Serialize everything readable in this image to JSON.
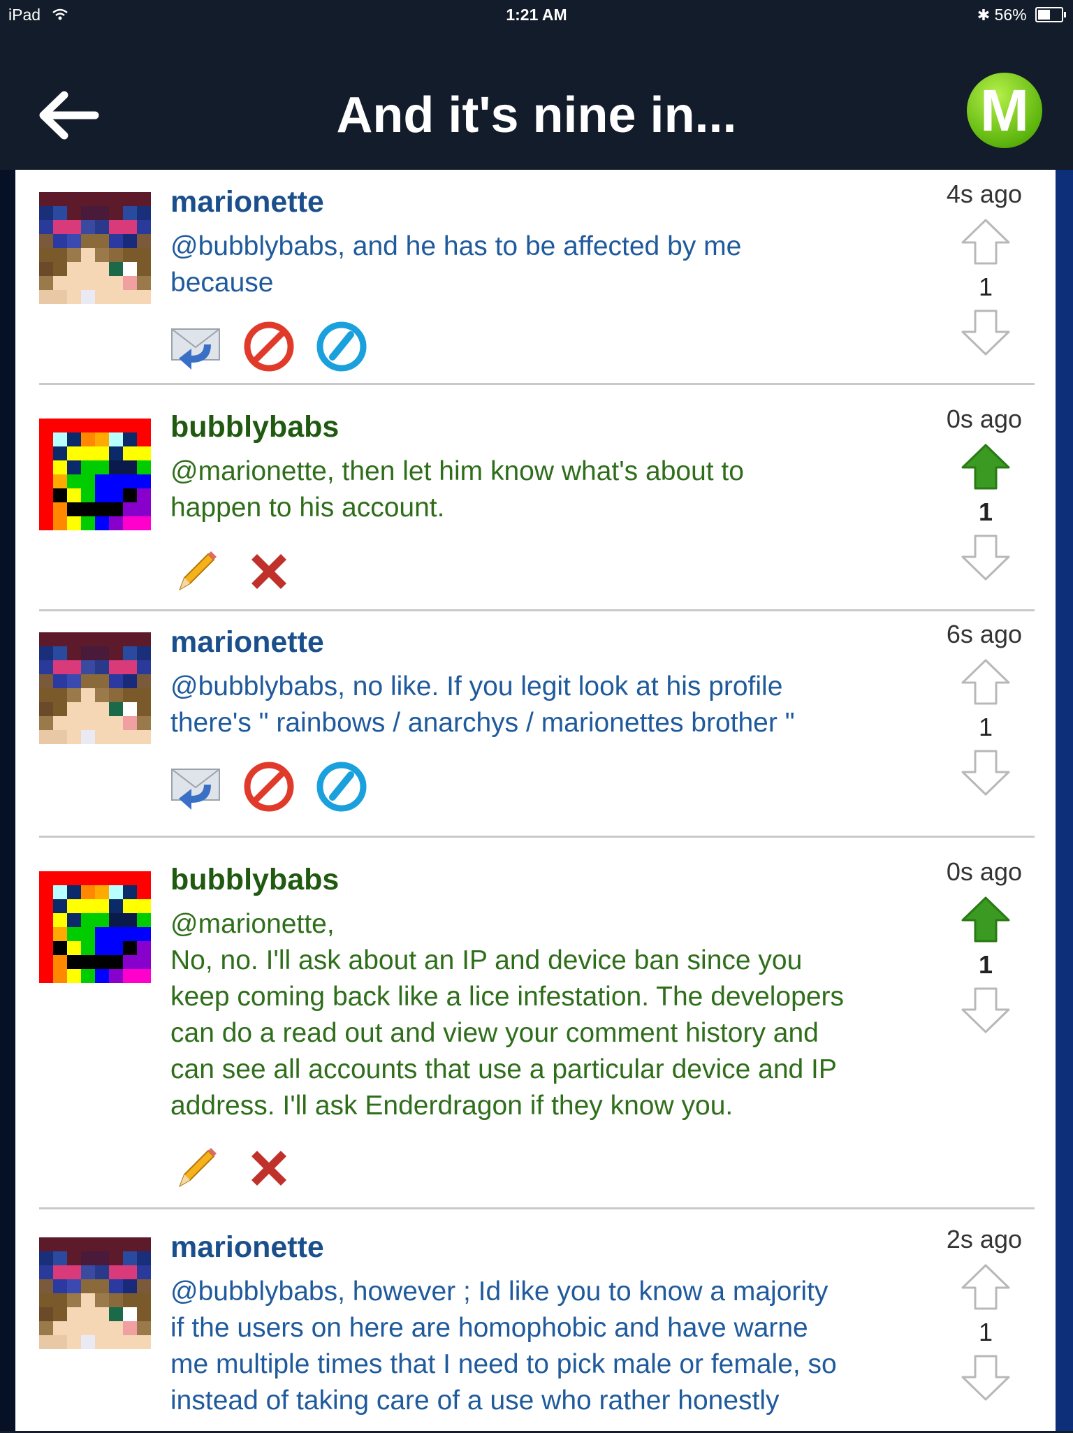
{
  "status_bar": {
    "device": "iPad",
    "time": "1:21 AM",
    "battery": "56%"
  },
  "header": {
    "title": "And it's nine in...",
    "logo_letter": "M"
  },
  "comments": [
    {
      "user": "marionette",
      "text": "@bubblybabs, and he has to be affected by me\nbecause",
      "time": "4s ago",
      "votes": "1",
      "upvoted": false
    },
    {
      "user": "bubblybabs",
      "text": "@marionette, then let him know what's about to\nhappen to his account.",
      "time": "0s ago",
      "votes": "1",
      "upvoted": true
    },
    {
      "user": "marionette",
      "text": "@bubblybabs, no like. If you legit look at his profile\nthere's \" rainbows / anarchys / marionettes brother \"",
      "time": "6s ago",
      "votes": "1",
      "upvoted": false
    },
    {
      "user": "bubblybabs",
      "text": "@marionette,\nNo, no. I'll ask about an IP and device ban since you\nkeep coming back like a lice infestation. The developers\ncan do a read out and view your comment history and\ncan see all accounts that use a particular device and IP\naddress. I'll ask Enderdragon if they know you.",
      "time": "0s ago",
      "votes": "1",
      "upvoted": true
    },
    {
      "user": "marionette",
      "text": "@bubblybabs, however ; Id like you to know a majority\nif the users on here are homophobic and have warne\nme multiple times that I need to pick male or female, so\ninstead of taking care of a use who rather honestly",
      "time": "2s ago",
      "votes": "1",
      "upvoted": false
    }
  ],
  "colors": {
    "accent_green": "#2f9a1e",
    "username_blue": "#1b4f8c",
    "username_green": "#1f5a10",
    "header_bg": "#131c2a"
  }
}
